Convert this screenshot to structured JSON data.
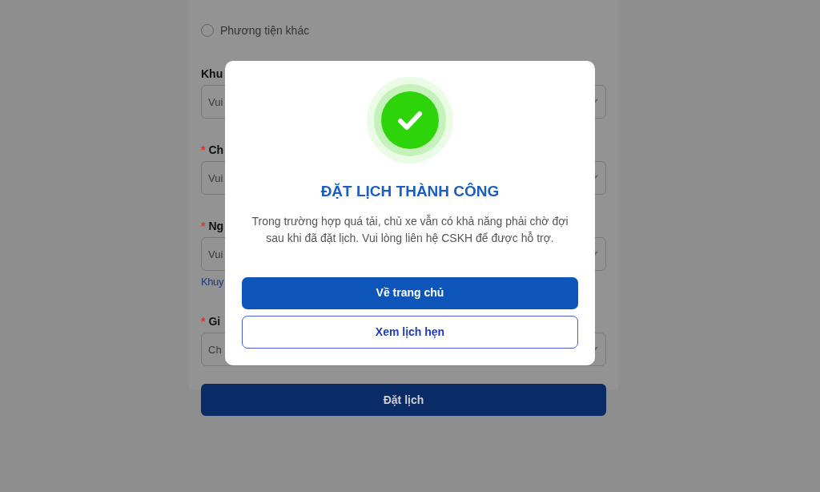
{
  "form": {
    "radio_options": [
      {
        "label": "Phương tiện khác",
        "selected": false
      }
    ],
    "fields": [
      {
        "label": "Khu",
        "placeholder": "Vui"
      },
      {
        "required_mark": "*",
        "label": "Ch",
        "placeholder": "Vui"
      },
      {
        "required_mark": "*",
        "label": "Ng",
        "placeholder": "Vui",
        "hint": "Khuy"
      },
      {
        "required_mark": "*",
        "label": "Gi",
        "placeholder": "Ch"
      }
    ],
    "submit": "Đặt lịch"
  },
  "modal": {
    "title": "ĐẶT LỊCH THÀNH CÔNG",
    "message": "Trong trường hợp quá tải, chủ xe vẫn có khả năng phải chờ đợi sau khi đã đặt lịch. Vui lòng liên hệ CSKH để được hỗ trợ.",
    "buttons": [
      {
        "label": "Về trang chủ",
        "kind": "primary"
      },
      {
        "label": "Xem lịch hẹn",
        "kind": "outline"
      }
    ]
  }
}
